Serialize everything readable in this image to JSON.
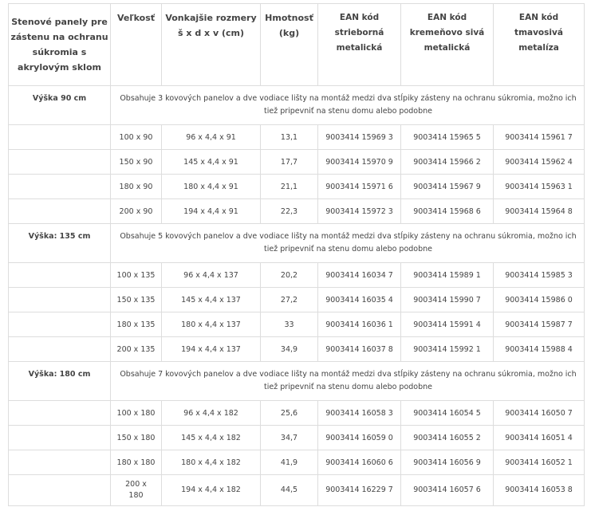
{
  "table": {
    "headers": [
      "Stenové panely pre zástenu na ochranu súkromia s akrylovým sklom",
      "Veľkosť",
      "Vonkajšie rozmery š x d x v (cm)",
      "Hmotnosť (kg)",
      "EAN kód strieborná metalická",
      "EAN kód kremeňovo sivá metalická",
      "EAN kód tmavosivá metalíza"
    ],
    "sections": [
      {
        "label": "Výška 90 cm",
        "description": "Obsahuje 3 kovových panelov a dve vodiace lišty na montáž medzi dva stĺpiky zásteny na ochranu súkromia, možno ich tiež pripevniť na stenu domu alebo podobne",
        "rows": [
          {
            "size": "100 x 90",
            "dims": "96 x 4,4 x 91",
            "weight": "13,1",
            "ean_silver": "9003414 15969 3",
            "ean_quartz": "9003414 15965 5",
            "ean_dark": "9003414 15961 7"
          },
          {
            "size": "150 x 90",
            "dims": "145 x 4,4 x 91",
            "weight": "17,7",
            "ean_silver": "9003414 15970 9",
            "ean_quartz": "9003414 15966 2",
            "ean_dark": "9003414 15962 4"
          },
          {
            "size": "180 x 90",
            "dims": "180 x 4,4 x 91",
            "weight": "21,1",
            "ean_silver": "9003414 15971 6",
            "ean_quartz": "9003414 15967 9",
            "ean_dark": "9003414 15963 1"
          },
          {
            "size": "200 x 90",
            "dims": "194 x 4,4 x 91",
            "weight": "22,3",
            "ean_silver": "9003414 15972 3",
            "ean_quartz": "9003414 15968 6",
            "ean_dark": "9003414 15964 8"
          }
        ]
      },
      {
        "label": "Výška: 135 cm",
        "description": "Obsahuje 5 kovových panelov a dve vodiace lišty na montáž medzi dva stĺpiky zásteny na ochranu súkromia, možno ich tiež pripevniť na stenu domu alebo podobne",
        "rows": [
          {
            "size": "100 x 135",
            "dims": "96 x 4,4 x 137",
            "weight": "20,2",
            "ean_silver": "9003414 16034 7",
            "ean_quartz": "9003414 15989 1",
            "ean_dark": "9003414 15985 3"
          },
          {
            "size": "150 x 135",
            "dims": "145 x 4,4 x 137",
            "weight": "27,2",
            "ean_silver": "9003414 16035 4",
            "ean_quartz": "9003414 15990 7",
            "ean_dark": "9003414 15986 0"
          },
          {
            "size": "180 x 135",
            "dims": "180 x 4,4 x 137",
            "weight": "33",
            "ean_silver": "9003414 16036 1",
            "ean_quartz": "9003414 15991 4",
            "ean_dark": "9003414 15987 7"
          },
          {
            "size": "200 x 135",
            "dims": "194 x 4,4 x 137",
            "weight": "34,9",
            "ean_silver": "9003414 16037 8",
            "ean_quartz": "9003414 15992 1",
            "ean_dark": "9003414 15988 4"
          }
        ]
      },
      {
        "label": "Výška: 180 cm",
        "description": "Obsahuje 7 kovových panelov a dve vodiace lišty na montáž medzi dva stĺpiky zásteny na ochranu súkromia, možno ich tiež pripevniť na stenu domu alebo podobne",
        "rows": [
          {
            "size": "100 x 180",
            "dims": "96 x 4,4 x 182",
            "weight": "25,6",
            "ean_silver": "9003414 16058 3",
            "ean_quartz": "9003414 16054 5",
            "ean_dark": "9003414 16050 7"
          },
          {
            "size": "150 x 180",
            "dims": "145 x 4,4 x 182",
            "weight": "34,7",
            "ean_silver": "9003414 16059 0",
            "ean_quartz": "9003414 16055 2",
            "ean_dark": "9003414 16051 4"
          },
          {
            "size": "180 x 180",
            "dims": "180 x 4,4 x 182",
            "weight": "41,9",
            "ean_silver": "9003414 16060 6",
            "ean_quartz": "9003414 16056 9",
            "ean_dark": "9003414 16052 1"
          },
          {
            "size": "200 x 180",
            "dims": "194 x 4,4 x 182",
            "weight": "44,5",
            "ean_silver": "9003414 16229 7",
            "ean_quartz": "9003414 16057 6",
            "ean_dark": "9003414 16053 8"
          }
        ]
      }
    ]
  }
}
